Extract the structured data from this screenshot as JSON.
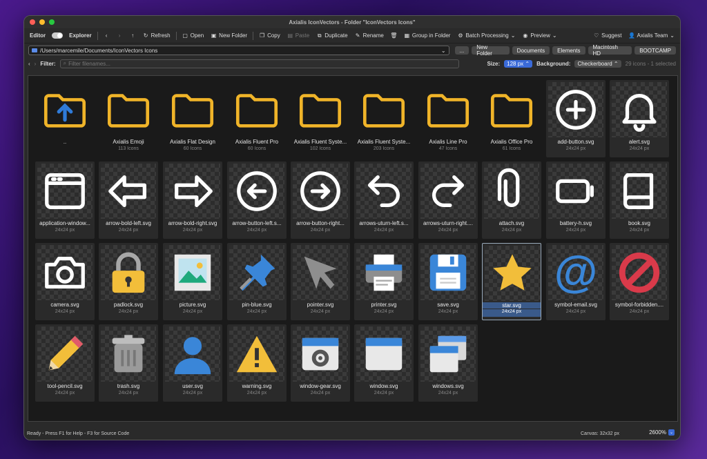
{
  "window": {
    "title": "Axialis IconVectors - Folder \"IconVectors Icons\""
  },
  "toolbar": {
    "editor": "Editor",
    "explorer": "Explorer",
    "refresh": "Refresh",
    "open": "Open",
    "new_folder": "New Folder",
    "copy": "Copy",
    "paste": "Paste",
    "duplicate": "Duplicate",
    "rename": "Rename",
    "group": "Group in Folder",
    "batch": "Batch Processing",
    "preview": "Preview",
    "suggest": "Suggest",
    "user": "Axialis Team"
  },
  "path": {
    "value": "/Users/marcemile/Documents/IconVectors Icons",
    "buttons": [
      "...",
      "New Folder",
      "Documents",
      "Elements",
      "Macintosh HD",
      "BOOTCAMP"
    ]
  },
  "filter": {
    "label": "Filter:",
    "placeholder": "Filter filenames...",
    "size_label": "Size:",
    "size_value": "128 px",
    "background_label": "Background:",
    "background_value": "Checkerboard",
    "count": "29 icons - 1 selected"
  },
  "items": [
    {
      "name": "..",
      "sub": ""
    },
    {
      "name": "Axialis Emoji",
      "sub": "113 Icons"
    },
    {
      "name": "Axialis Flat Design",
      "sub": "60 Icons"
    },
    {
      "name": "Axialis Fluent Pro",
      "sub": "60 Icons"
    },
    {
      "name": "Axialis Fluent Syste...",
      "sub": "102 Icons"
    },
    {
      "name": "Axialis Fluent Syste...",
      "sub": "203 Icons"
    },
    {
      "name": "Axialis Line Pro",
      "sub": "47 Icons"
    },
    {
      "name": "Axialis Office Pro",
      "sub": "61 Icons"
    },
    {
      "name": "add-button.svg",
      "sub": "24x24 px"
    },
    {
      "name": "alert.svg",
      "sub": "24x24 px"
    },
    {
      "name": "application-window...",
      "sub": "24x24 px"
    },
    {
      "name": "arrow-bold-left.svg",
      "sub": "24x24 px"
    },
    {
      "name": "arrow-bold-right.svg",
      "sub": "24x24 px"
    },
    {
      "name": "arrow-button-left.s...",
      "sub": "24x24 px"
    },
    {
      "name": "arrow-button-right...",
      "sub": "24x24 px"
    },
    {
      "name": "arrows-uturn-left.s...",
      "sub": "24x24 px"
    },
    {
      "name": "arrows-uturn-right....",
      "sub": "24x24 px"
    },
    {
      "name": "attach.svg",
      "sub": "24x24 px"
    },
    {
      "name": "battery-h.svg",
      "sub": "24x24 px"
    },
    {
      "name": "book.svg",
      "sub": "24x24 px"
    },
    {
      "name": "camera.svg",
      "sub": "24x24 px"
    },
    {
      "name": "padlock.svg",
      "sub": "24x24 px"
    },
    {
      "name": "picture.svg",
      "sub": "24x24 px"
    },
    {
      "name": "pin-blue.svg",
      "sub": "24x24 px"
    },
    {
      "name": "pointer.svg",
      "sub": "24x24 px"
    },
    {
      "name": "printer.svg",
      "sub": "24x24 px"
    },
    {
      "name": "save.svg",
      "sub": "24x24 px"
    },
    {
      "name": "star.svg",
      "sub": "24x24 px"
    },
    {
      "name": "symbol-email.svg",
      "sub": "24x24 px"
    },
    {
      "name": "symbol-forbidden....",
      "sub": "24x24 px"
    },
    {
      "name": "tool-pencil.svg",
      "sub": "24x24 px"
    },
    {
      "name": "trash.svg",
      "sub": "24x24 px"
    },
    {
      "name": "user.svg",
      "sub": "24x24 px"
    },
    {
      "name": "warning.svg",
      "sub": "24x24 px"
    },
    {
      "name": "window-gear.svg",
      "sub": "24x24 px"
    },
    {
      "name": "window.svg",
      "sub": "24x24 px"
    },
    {
      "name": "windows.svg",
      "sub": "24x24 px"
    }
  ],
  "status": {
    "left": "Ready - Press F1 for Help - F3 for Source Code",
    "canvas": "Canvas: 32x32 px",
    "zoom": "2600%"
  },
  "colors": {
    "folder": "#f0b429",
    "accent": "#3a6ad8",
    "selection": "#3a5a8a"
  }
}
